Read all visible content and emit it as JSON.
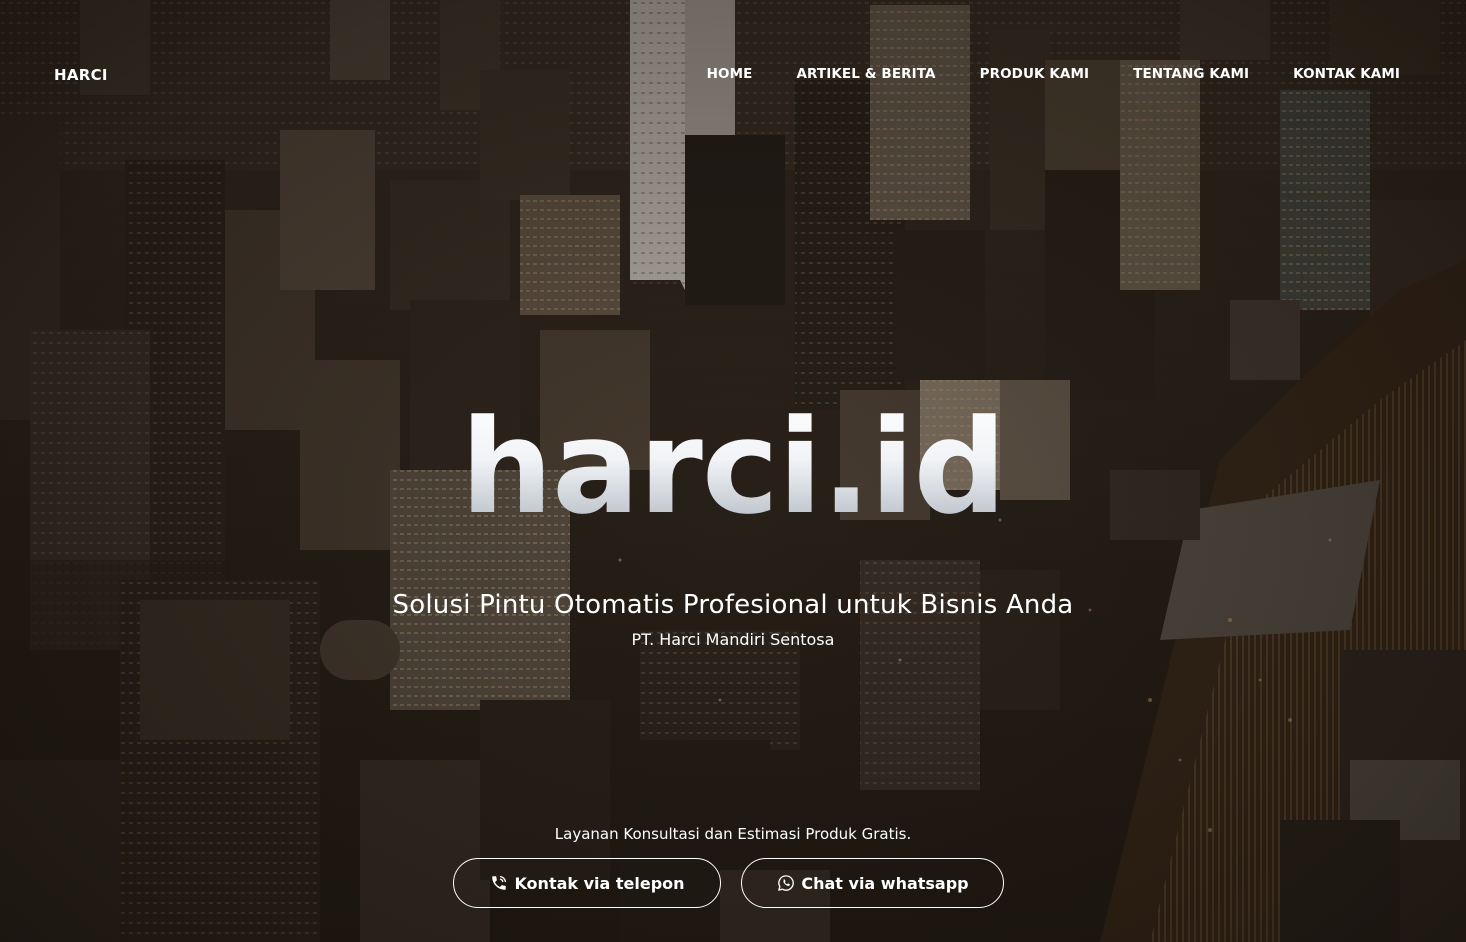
{
  "nav": {
    "brand": "HARCI",
    "items": [
      {
        "label": "HOME"
      },
      {
        "label": "ARTIKEL & BERITA"
      },
      {
        "label": "PRODUK KAMI"
      },
      {
        "label": "TENTANG KAMI"
      },
      {
        "label": "KONTAK KAMI"
      }
    ]
  },
  "hero": {
    "title": "harci.id",
    "subtitle": "Solusi Pintu Otomatis Profesional untuk Bisnis Anda",
    "company": "PT. Harci Mandiri Sentosa",
    "consult_text": "Layanan Konsultasi dan Estimasi Produk Gratis.",
    "phone_button": "Kontak via telepon",
    "whatsapp_button": "Chat via whatsapp",
    "phone_icon": "phone-volume-icon",
    "whatsapp_icon": "whatsapp-icon",
    "background": "aerial-city-photo"
  },
  "colors": {
    "text": "#ffffff",
    "title_gradient_top": "#ffffff",
    "title_gradient_bottom": "#a3acb6",
    "background_tone": "#2a2119"
  }
}
